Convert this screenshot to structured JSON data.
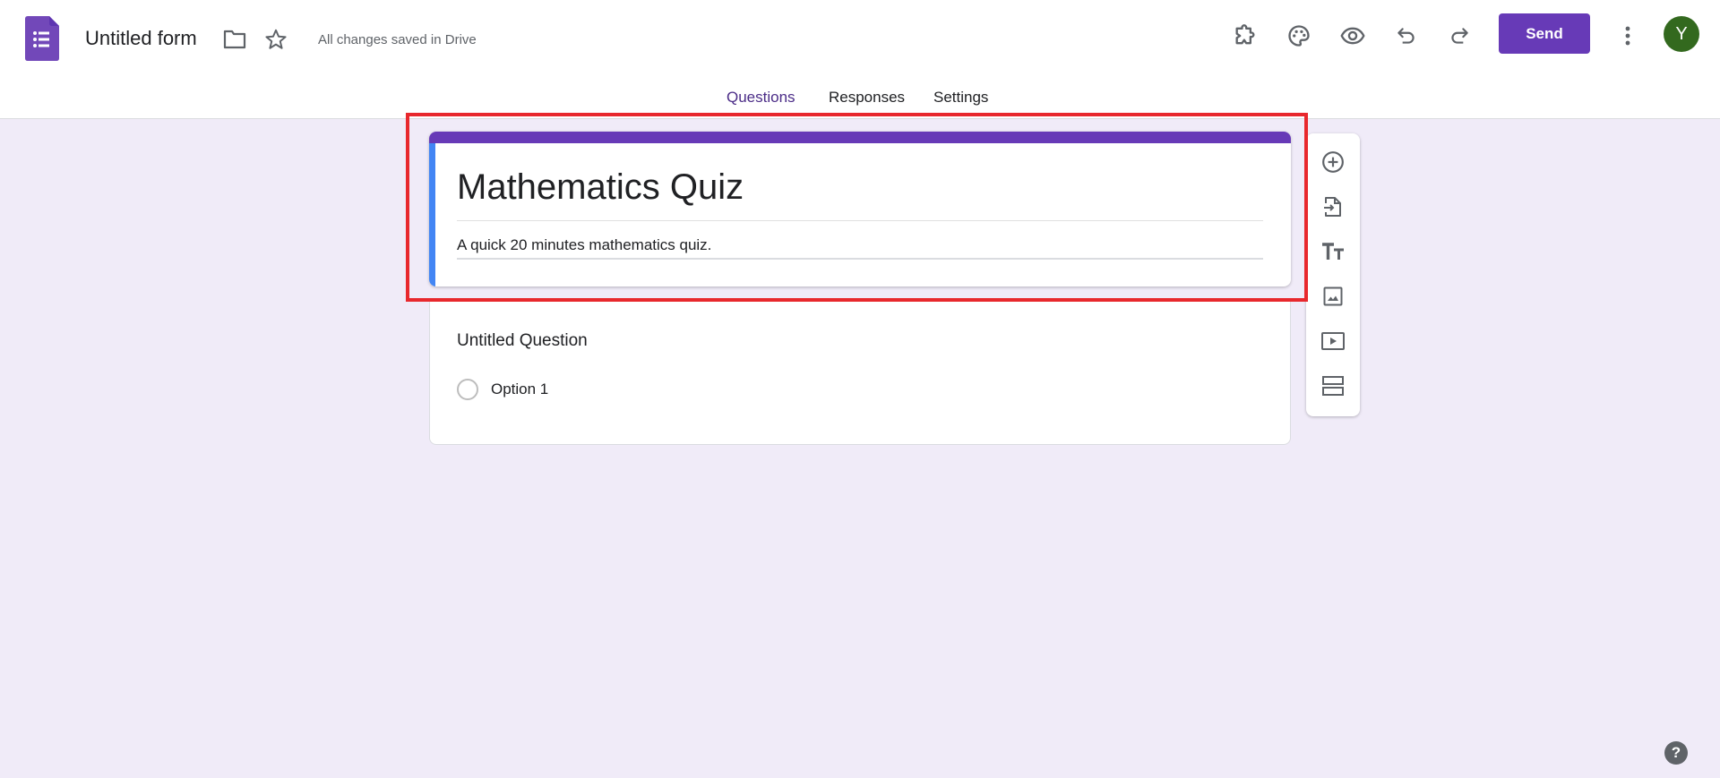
{
  "header": {
    "app_icon": "google-forms-icon",
    "doc_title": "Untitled form",
    "folder_icon": "folder-icon",
    "star_icon": "star-icon",
    "save_status": "All changes saved in Drive",
    "toolbar_icons": [
      "addon-icon",
      "palette-icon",
      "preview-eye-icon",
      "undo-icon",
      "redo-icon"
    ],
    "send_label": "Send",
    "more_icon": "more-vert-icon",
    "avatar_initial": "Y",
    "colors": {
      "brand": "#673ab7",
      "avatar": "#33691e"
    }
  },
  "tabs": [
    {
      "label": "Questions",
      "active": true
    },
    {
      "label": "Responses",
      "active": false
    },
    {
      "label": "Settings",
      "active": false
    }
  ],
  "form": {
    "title": "Mathematics Quiz",
    "description": "A quick 20 minutes mathematics quiz.",
    "accent_color": "#673ab7",
    "focus_color": "#4285f4"
  },
  "question": {
    "title": "Untitled Question",
    "options": [
      {
        "label": "Option 1"
      }
    ]
  },
  "side_toolbar": [
    {
      "icon": "add-circle-icon",
      "label": "Add question"
    },
    {
      "icon": "import-question-icon",
      "label": "Import questions"
    },
    {
      "icon": "title-text-icon",
      "label": "Add title and description"
    },
    {
      "icon": "image-icon",
      "label": "Add image"
    },
    {
      "icon": "video-icon",
      "label": "Add video"
    },
    {
      "icon": "section-icon",
      "label": "Add section"
    }
  ],
  "help": {
    "icon": "help-icon",
    "glyph": "?"
  },
  "annotation": {
    "highlight_color": "#e8282d"
  }
}
